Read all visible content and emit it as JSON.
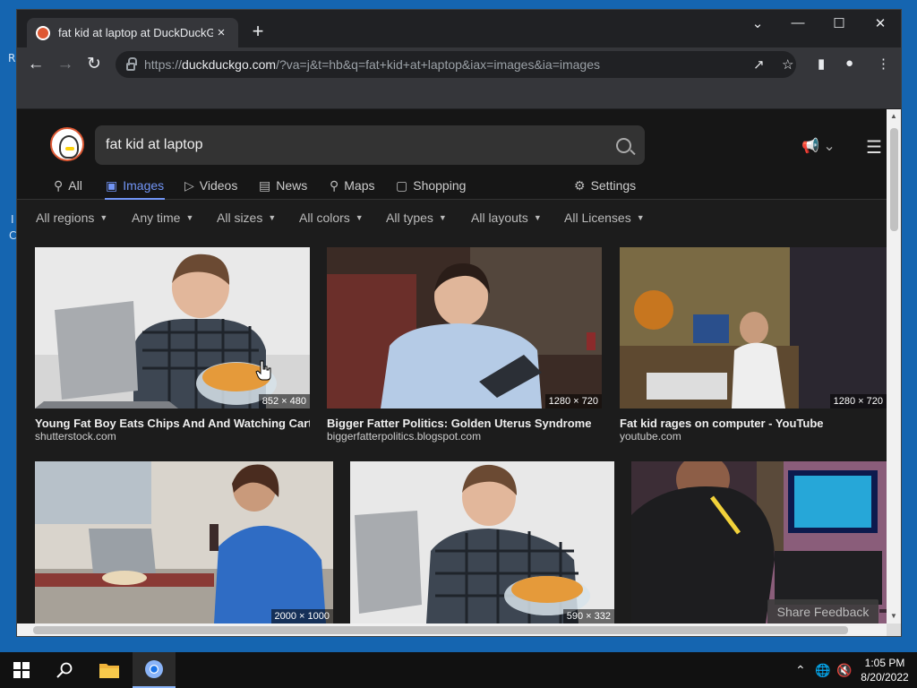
{
  "desktop": {
    "frag_r": "R",
    "frag_i": "I",
    "frag_c": "C"
  },
  "browser": {
    "tab_title": "fat kid at laptop at DuckDuckGo",
    "tab_close": "×",
    "new_tab": "+",
    "url_scheme": "https://",
    "url_host": "duckduckgo.com",
    "url_rest": "/?va=j&t=hb&q=fat+kid+at+laptop&iax=images&ia=images",
    "controls": {
      "dropdown": "⌄",
      "minimize": "—",
      "maximize": "☐",
      "close": "✕"
    }
  },
  "search": {
    "query": "fat kid at laptop"
  },
  "tabs": [
    {
      "label": "All",
      "icon": "search-icon"
    },
    {
      "label": "Images",
      "icon": "image-icon"
    },
    {
      "label": "Videos",
      "icon": "play-icon"
    },
    {
      "label": "News",
      "icon": "news-icon"
    },
    {
      "label": "Maps",
      "icon": "map-pin-icon"
    },
    {
      "label": "Shopping",
      "icon": "shopping-bag-icon"
    },
    {
      "label": "Settings",
      "icon": "sliders-icon"
    }
  ],
  "filters": [
    "All regions",
    "Any time",
    "All sizes",
    "All colors",
    "All types",
    "All layouts",
    "All Licenses"
  ],
  "results": [
    {
      "title": "Young Fat Boy Eats Chips And And Watching Cart...",
      "source": "shutterstock.com",
      "dims": "852 × 480"
    },
    {
      "title": "Bigger Fatter Politics: Golden Uterus Syndrome",
      "source": "biggerfatterpolitics.blogspot.com",
      "dims": "1280 × 720"
    },
    {
      "title": "Fat kid rages on computer - YouTube",
      "source": "youtube.com",
      "dims": "1280 × 720"
    },
    {
      "title": "",
      "source": "",
      "dims": "2000 × 1000"
    },
    {
      "title": "",
      "source": "",
      "dims": "590 × 332"
    },
    {
      "title": "",
      "source": "",
      "dims": ""
    }
  ],
  "feedback": "Share Feedback",
  "taskbar": {
    "time": "1:05 PM",
    "date": "8/20/2022"
  },
  "colors": {
    "accent": "#7295f6",
    "ddg_orange": "#de5833",
    "page_bg": "#1c1c1c"
  }
}
